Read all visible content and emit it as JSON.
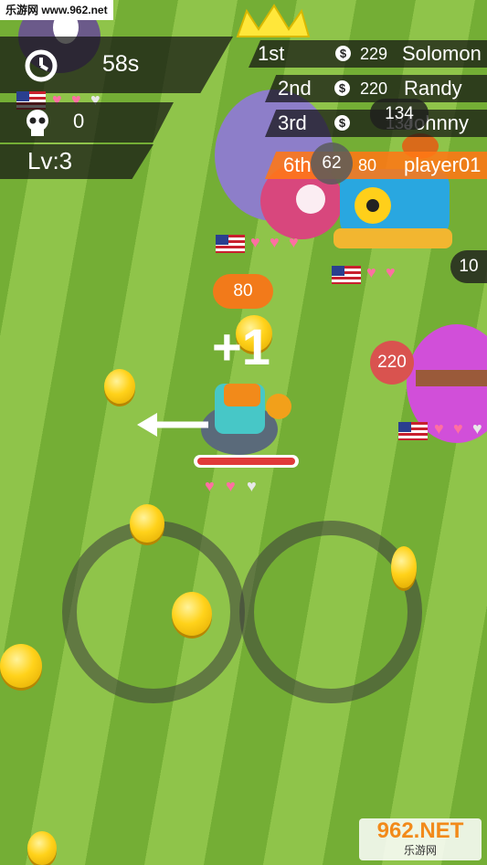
{
  "watermark_top": "乐游网 www.962.net",
  "hud": {
    "timer": "58s",
    "kills": "0",
    "level": "Lv:3"
  },
  "leaderboard": [
    {
      "rank": "1st",
      "score": "229",
      "name": "Solomon"
    },
    {
      "rank": "2nd",
      "score": "220",
      "name": "Randy"
    },
    {
      "rank": "3rd",
      "score": "134",
      "name": "Johnny"
    },
    {
      "rank": "6th",
      "score": "80",
      "name": "player01"
    }
  ],
  "player": {
    "score_bubble": "80",
    "pickup_text": "+1",
    "hearts_full": 2,
    "hearts_total": 3
  },
  "enemies": {
    "penguin_score": "62",
    "tank_score": "134",
    "pink_score": "220",
    "offscreen_score": "10"
  },
  "watermark_bottom": {
    "logo": "962.NET",
    "sub": "乐游网"
  },
  "icons": [
    "clock-icon",
    "skull-icon",
    "dollar-coin-icon",
    "crown-icon",
    "us-flag-icon",
    "heart-icon",
    "direction-arrow-icon"
  ]
}
